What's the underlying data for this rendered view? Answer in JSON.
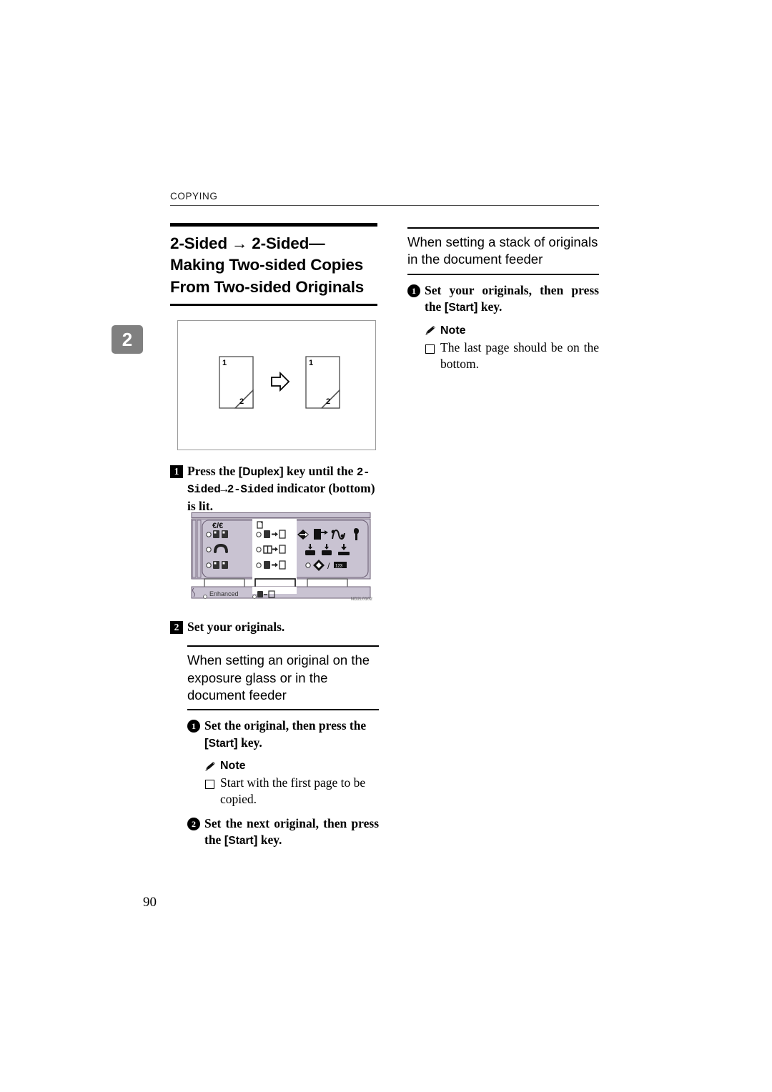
{
  "page": {
    "running_head": "COPYING",
    "folio": "90",
    "chapter_tab": "2"
  },
  "left_column": {
    "section_title": "2-Sided → 2-Sided—Making Two-sided Copies From Two-sided Originals",
    "figure_duplex": {
      "name": "two-sided-to-two-sided-diagram",
      "source_sheet": {
        "front_label": "1",
        "back_label": "2"
      },
      "arrow": "→",
      "result_sheet": {
        "front_label": "1",
        "back_label": "2"
      }
    },
    "step1": {
      "marker": "1",
      "text_part1": "Press the ",
      "key": "Duplex",
      "text_part2": " key until the ",
      "mono1": "2-Sided→2-Sided",
      "text_part3": " indicator (bottom) is lit."
    },
    "figure_panel": {
      "name": "copier-control-panel-illustration",
      "label_enhanced": "Enhanced",
      "code": "ND2L0102"
    },
    "step2": {
      "marker": "2",
      "text": "Set your originals."
    },
    "subhead": "When setting an original on the exposure glass or in the document feeder",
    "substep1": {
      "marker": "1",
      "text_part1": "Set the original, then press the ",
      "key": "Start",
      "text_part2": " key."
    },
    "note1": {
      "title": "Note",
      "items": [
        "Start with the first page to be copied."
      ]
    },
    "substep2": {
      "marker": "2",
      "text_part1": "Set the next original, then press the ",
      "key": "Start",
      "text_part2": " key."
    }
  },
  "right_column": {
    "subhead": "When setting a stack of originals in the document feeder",
    "substep1": {
      "marker": "1",
      "text_part1": "Set your originals, then press the ",
      "key": "Start",
      "text_part2": " key."
    },
    "note1": {
      "title": "Note",
      "items": [
        "The last page should be on the bottom."
      ]
    }
  },
  "colors": {
    "panel_body": "#c9c3d2",
    "panel_inset": "#ffffff",
    "panel_frame": "#6d6076",
    "tab_gray": "#808080",
    "rule_black": "#000000"
  }
}
